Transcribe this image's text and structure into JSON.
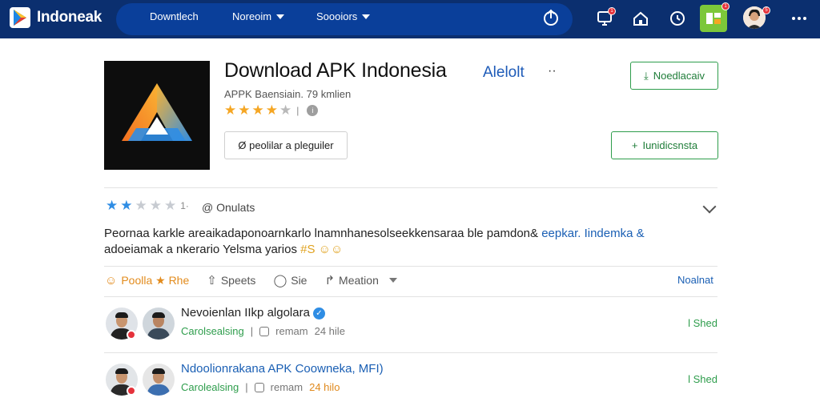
{
  "topbar": {
    "brand": "Indoneak",
    "nav": [
      {
        "label": "Downtlech",
        "has_caret": false
      },
      {
        "label": "Noreoim",
        "has_caret": true
      },
      {
        "label": "Soooiors",
        "has_caret": true
      }
    ],
    "badges": {
      "monitor": "1",
      "tile": "1",
      "avatar": "5"
    }
  },
  "app": {
    "title": "Download APK Indonesia",
    "tag": "Alelolt",
    "tag_more": "··",
    "meta": "APPK Baensiain.  79 kmlien",
    "rating_stars": 4,
    "rating_sep": "|",
    "rating_info": "i",
    "primary_action": "Noedlacaiv",
    "secondary_action": "Iunidicsnsta",
    "pill_button": "Ø peolilar a pleguiler",
    "accent": "#0b2f6f",
    "green": "#2e9d4c"
  },
  "review": {
    "stars": 2,
    "stars_suffix": "1·",
    "author": "@ Onulats",
    "text_part1": "Peornaa karkle areaikadaponoarnkarlo lnamnhanesolseekkensaraa ble pamdon&",
    "text_blue": "eepkar. Iindemka &",
    "text_part2": "adoeiamak a nkerario Yelsma yarios",
    "text_emoji": "#S ☺☺"
  },
  "actions": {
    "items": [
      {
        "icon": "☺",
        "label": "Poolla ★ Rhe"
      },
      {
        "icon": "⇧",
        "label": "Speets"
      },
      {
        "icon": "◯",
        "label": "Sie"
      },
      {
        "icon": "↱",
        "label": "Meation"
      }
    ],
    "right": "Noalnat"
  },
  "rows": [
    {
      "title": "Nevoienlan IIkp algolara",
      "verified": true,
      "sub_green": "Carolsealsing",
      "sub_sep": "|",
      "sub_mid": "remam",
      "sub_tail": "24 hile",
      "right": "l  Shed",
      "title_color": "#111111"
    },
    {
      "title": "Ndoolionrakana APK Coowneka, MFI)",
      "verified": false,
      "sub_green": "Carolealsing",
      "sub_sep": "|",
      "sub_mid": "remam",
      "sub_tail": "24 hilo",
      "right": "l  Shed",
      "title_color": "#1a5fb4"
    }
  ]
}
